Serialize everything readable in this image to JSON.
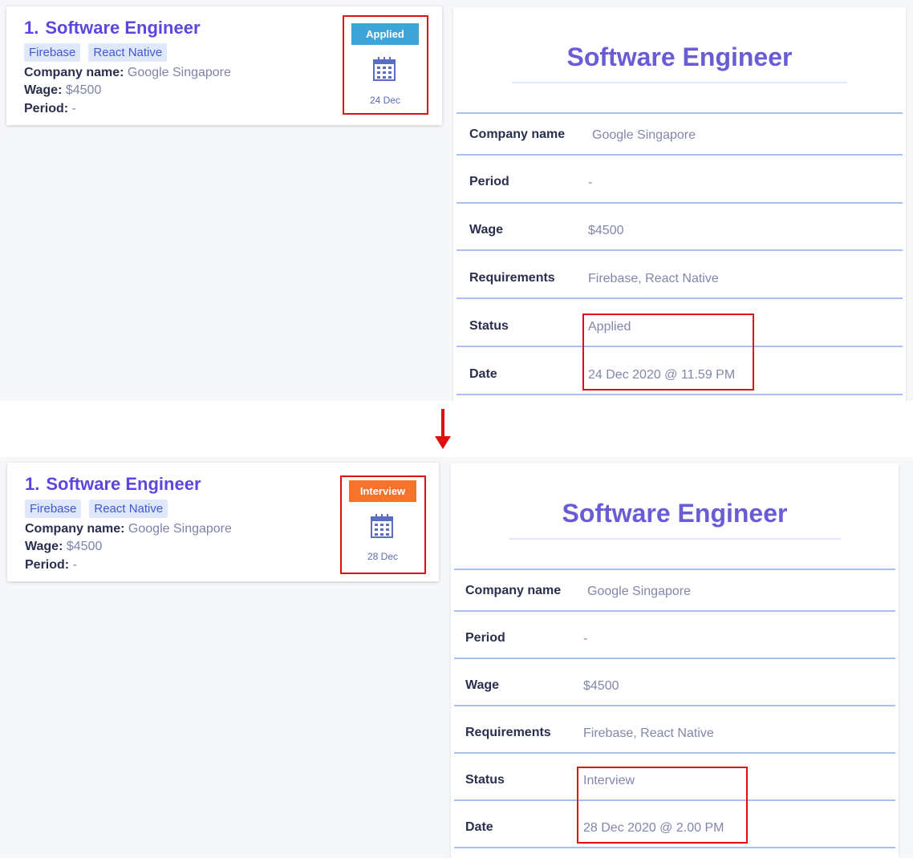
{
  "before": {
    "card": {
      "index": "1.",
      "title": "Software Engineer",
      "tags": [
        "Firebase",
        "React Native"
      ],
      "company_label": "Company name:",
      "company": "Google Singapore",
      "wage_label": "Wage:",
      "wage": "$4500",
      "period_label": "Period:",
      "period": "-",
      "status": "Applied",
      "date_short": "24 Dec"
    },
    "detail": {
      "title": "Software Engineer",
      "rows": [
        {
          "label": "Company name",
          "value": "Google Singapore"
        },
        {
          "label": "Period",
          "value": "-"
        },
        {
          "label": "Wage",
          "value": "$4500"
        },
        {
          "label": "Requirements",
          "value": "Firebase, React Native"
        },
        {
          "label": "Status",
          "value": "Applied"
        },
        {
          "label": "Date",
          "value": "24 Dec 2020 @ 11.59 PM"
        }
      ]
    }
  },
  "after": {
    "card": {
      "index": "1.",
      "title": "Software Engineer",
      "tags": [
        "Firebase",
        "React Native"
      ],
      "company_label": "Company name:",
      "company": "Google Singapore",
      "wage_label": "Wage:",
      "wage": "$4500",
      "period_label": "Period:",
      "period": "-",
      "status": "Interview",
      "date_short": "28 Dec"
    },
    "detail": {
      "title": "Software Engineer",
      "rows": [
        {
          "label": "Company name",
          "value": "Google Singapore"
        },
        {
          "label": "Period",
          "value": "-"
        },
        {
          "label": "Wage",
          "value": "$4500"
        },
        {
          "label": "Requirements",
          "value": "Firebase, React Native"
        },
        {
          "label": "Status",
          "value": "Interview"
        },
        {
          "label": "Date",
          "value": "28 Dec 2020 @ 2.00 PM"
        }
      ]
    }
  },
  "colors": {
    "applied": "#3ea5d9",
    "interview": "#f5732a",
    "highlight": "#e01010",
    "title": "#5b46e0"
  },
  "icons": {
    "calendar": "calendar-icon",
    "arrow": "arrow-down-icon"
  }
}
